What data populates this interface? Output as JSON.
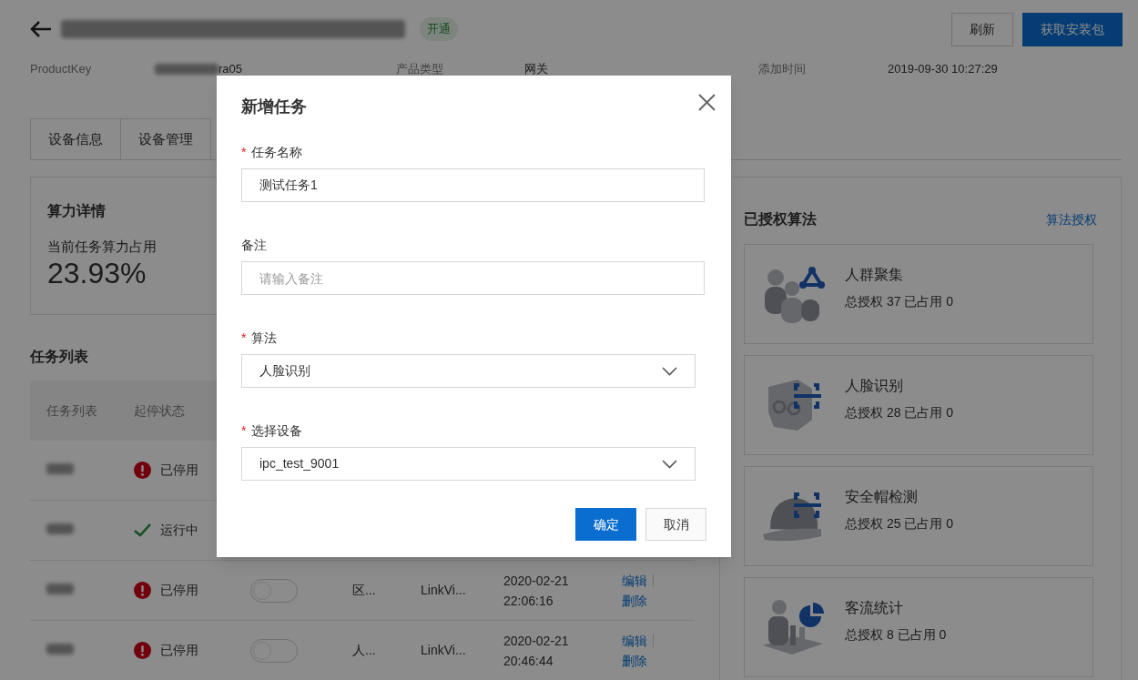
{
  "header": {
    "status_badge": "开通",
    "buttons": [
      {
        "label": "刷新",
        "kind": "secondary"
      },
      {
        "label": "获取安装包",
        "kind": "primary"
      }
    ]
  },
  "info": [
    {
      "label": "ProductKey",
      "value": "ra05",
      "redacted_prefix": true
    },
    {
      "label": "产品类型",
      "value": "网关",
      "redacted_prefix": false
    },
    {
      "label": "添加时间",
      "value": "2019-09-30 10:27:29",
      "redacted_prefix": false
    }
  ],
  "tabs": [
    "设备信息",
    "设备管理"
  ],
  "compute": {
    "title": "算力详情",
    "label": "当前任务算力占用",
    "value": "23.93%"
  },
  "tasks": {
    "title": "任务列表",
    "columns": [
      "任务列表",
      "起停状态"
    ],
    "rows": [
      {
        "kind": "stopped",
        "status": "已停用"
      },
      {
        "kind": "running",
        "status": "运行中"
      },
      {
        "kind": "stopped",
        "status": "已停用",
        "on": false,
        "column_3": "区...",
        "column_4": "LinkVi...",
        "date": "2020-02-21",
        "time": "22:06:16",
        "actions": [
          "编辑",
          "删除"
        ]
      },
      {
        "kind": "stopped",
        "status": "已停用",
        "on": false,
        "column_3": "人...",
        "column_4": "LinkVi...",
        "date": "2020-02-21",
        "time": "20:46:44",
        "actions": [
          "编辑",
          "删除"
        ]
      }
    ]
  },
  "algorithms": {
    "title": "已授权算法",
    "link": "算法授权",
    "items": [
      {
        "kind": "crowd",
        "name": "人群聚集",
        "stats": "总授权 37 已占用 0"
      },
      {
        "kind": "face",
        "name": "人脸识别",
        "stats": "总授权 28 已占用 0"
      },
      {
        "kind": "helmet",
        "name": "安全帽检测",
        "stats": "总授权 25 已占用 0"
      },
      {
        "kind": "traffic",
        "name": "客流统计",
        "stats": "总授权 8 已占用 0"
      }
    ]
  },
  "dialog": {
    "title": "新增任务",
    "required_mark": "*",
    "fields": [
      {
        "kind": "input",
        "label": "任务名称",
        "required": true,
        "value": "测试任务1"
      },
      {
        "kind": "input",
        "label": "备注",
        "required": false,
        "placeholder": "请输入备注"
      },
      {
        "kind": "select",
        "label": "算法",
        "required": true,
        "value": "人脸识别"
      },
      {
        "kind": "select",
        "label": "选择设备",
        "required": true,
        "value": "ipc_test_9001"
      }
    ],
    "buttons": [
      {
        "label": "确定",
        "kind": "primary"
      },
      {
        "label": "取消",
        "kind": "secondary"
      }
    ]
  }
}
